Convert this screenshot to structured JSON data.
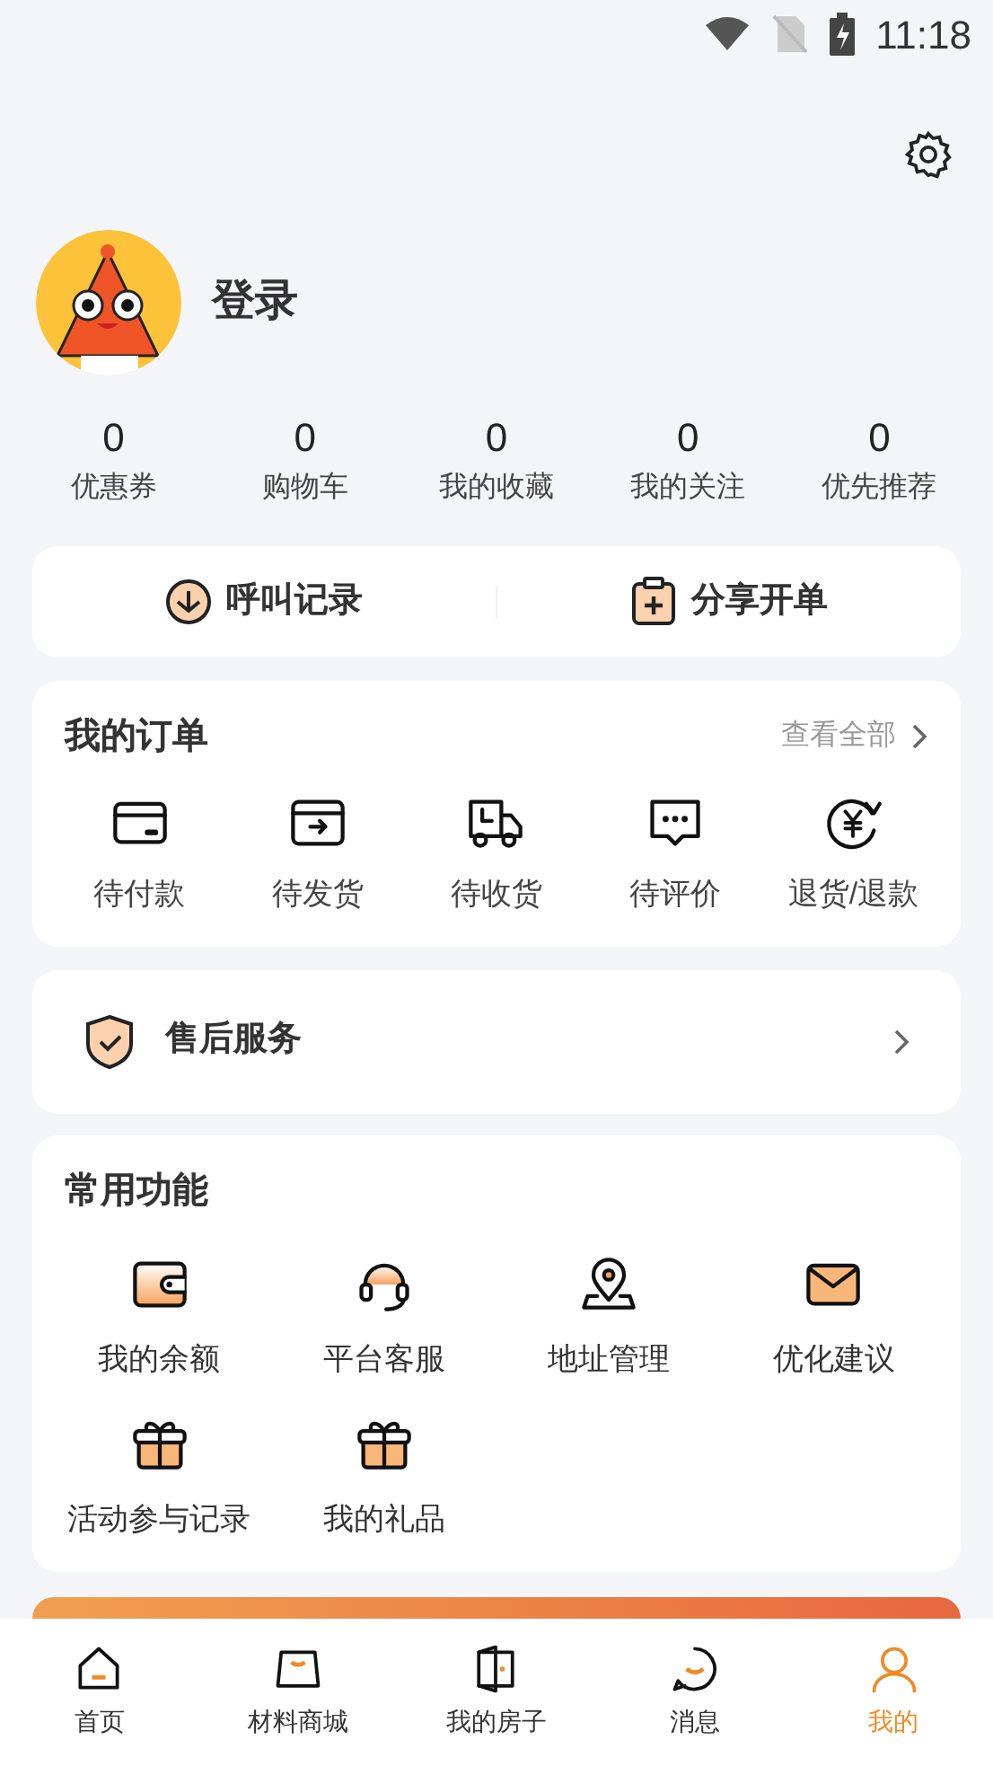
{
  "status_bar": {
    "time": "11:18"
  },
  "profile": {
    "name": "登录"
  },
  "stats": [
    {
      "value": "0",
      "label": "优惠券"
    },
    {
      "value": "0",
      "label": "购物车"
    },
    {
      "value": "0",
      "label": "我的收藏"
    },
    {
      "value": "0",
      "label": "我的关注"
    },
    {
      "value": "0",
      "label": "优先推荐"
    }
  ],
  "quick_actions": [
    {
      "label": "呼叫记录"
    },
    {
      "label": "分享开单"
    }
  ],
  "orders": {
    "title": "我的订单",
    "view_all": "查看全部",
    "items": [
      {
        "label": "待付款"
      },
      {
        "label": "待发货"
      },
      {
        "label": "待收货"
      },
      {
        "label": "待评价"
      },
      {
        "label": "退货/退款"
      }
    ]
  },
  "after_sales": {
    "label": "售后服务"
  },
  "functions": {
    "title": "常用功能",
    "items": [
      {
        "label": "我的余额"
      },
      {
        "label": "平台客服"
      },
      {
        "label": "地址管理"
      },
      {
        "label": "优化建议"
      },
      {
        "label": "活动参与记录"
      },
      {
        "label": "我的礼品"
      }
    ]
  },
  "tab_bar": [
    {
      "label": "首页",
      "selected": false
    },
    {
      "label": "材料商城",
      "selected": false
    },
    {
      "label": "我的房子",
      "selected": false
    },
    {
      "label": "消息",
      "selected": false
    },
    {
      "label": "我的",
      "selected": true
    }
  ]
}
